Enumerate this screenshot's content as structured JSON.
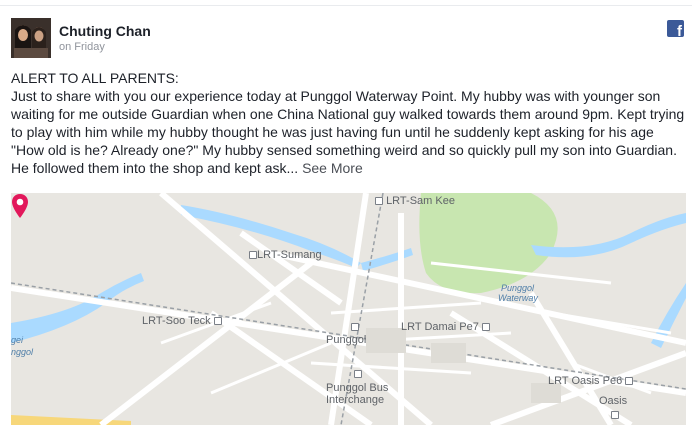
{
  "post": {
    "author": "Chuting Chan",
    "timestamp": "on Friday",
    "paragraph1": "ALERT TO ALL PARENTS:",
    "paragraph2": "Just to share with you our experience today at Punggol Waterway Point. My hubby was with younger son waiting for me outside Guardian when one China National guy walked towards them around 9pm. Kept trying to play with him while my hubby thought he was just having fun until he suddenly kept asking for his age \"How old is he? Already one?\" My hubby sensed something weird and so quickly pull my son into Guardian. He followed them into the shop and kept ask...",
    "see_more": "See More",
    "brand_icon": "facebook-logo"
  },
  "map": {
    "labels": {
      "sam_kee": "LRT-Sam Kee",
      "sumang": "LRT-Sumang",
      "soo_teck": "LRT-Soo Teck",
      "punggol": "Punggol",
      "damai": "LRT Damai Pe7",
      "punggol_bus": "Punggol Bus",
      "interchange": "Interchange",
      "oasis_pe6": "LRT Oasis Pe6",
      "oasis": "Oasis",
      "waterway_1": "Punggol",
      "waterway_2": "Waterway",
      "left_water_1": "gei",
      "left_water_2": "nggol"
    },
    "colors": {
      "land": "#e8e6e1",
      "water": "#aadaff",
      "park": "#c8e6b0",
      "road": "#ffffff",
      "rail": "#9aa0a6",
      "beach": "#f7d77a",
      "pin": "#e2185b"
    }
  }
}
